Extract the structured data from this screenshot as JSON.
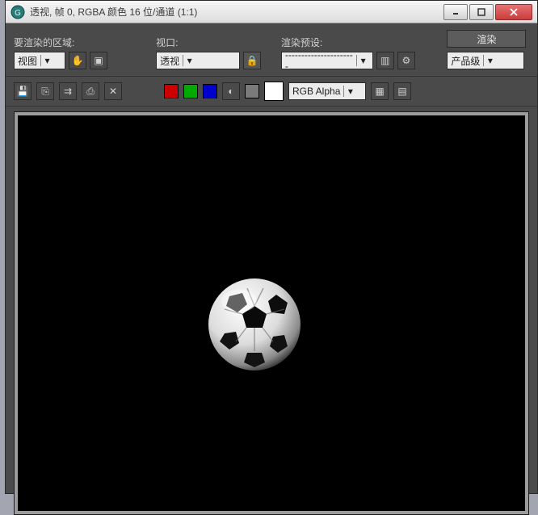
{
  "titlebar": {
    "title": "透视, 帧 0, RGBA 颜色 16 位/通道 (1:1)"
  },
  "controls": {
    "area": {
      "label": "要渲染的区域:",
      "value": "视图"
    },
    "viewport": {
      "label": "视口:",
      "value": "透视"
    },
    "preset": {
      "label": "渲染预设:",
      "value": "----------------------"
    },
    "render_button": "渲染",
    "production": {
      "value": "产品级"
    }
  },
  "toolbar": {
    "channel": "RGB Alpha"
  },
  "icons": {
    "hand": "✋",
    "region": "▣",
    "lock": "🔒",
    "gear": "⚙",
    "save": "💾",
    "copy": "⎘",
    "clone": "⇉",
    "print": "⎙",
    "delete": "✕",
    "alpha": "◐",
    "toggle1": "▦",
    "toggle2": "▤"
  }
}
